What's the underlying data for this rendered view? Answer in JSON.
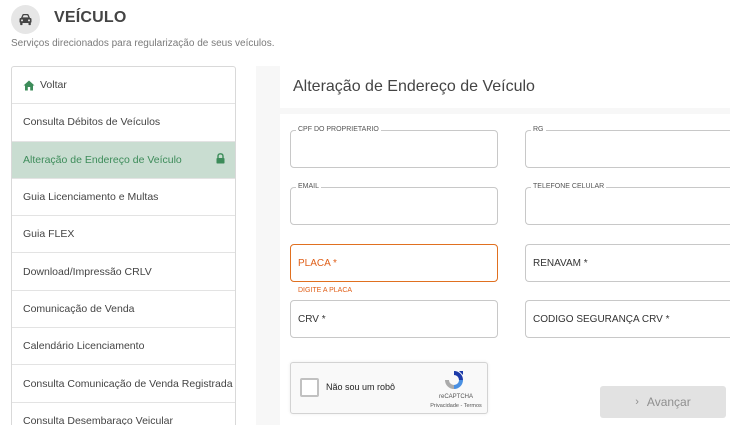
{
  "header": {
    "icon": "car-icon",
    "title": "VEÍCULO",
    "subtitle": "Serviços direcionados para regularização de seus veículos."
  },
  "sidebar": {
    "back_label": "Voltar",
    "items": [
      {
        "label": "Consulta Débitos de Veículos"
      },
      {
        "label": "Alteração de Endereço de Veículo",
        "active": true,
        "icon": "lock-icon"
      },
      {
        "label": "Guia Licenciamento e Multas"
      },
      {
        "label": "Guia FLEX"
      },
      {
        "label": "Download/Impressão CRLV"
      },
      {
        "label": "Comunicação de Venda"
      },
      {
        "label": "Calendário Licenciamento"
      },
      {
        "label": "Consulta Comunicação de Venda Registrada"
      },
      {
        "label": "Consulta Desembaraço Veicular"
      }
    ]
  },
  "form": {
    "title": "Alteração de Endereço de Veículo",
    "cpf_label": "CPF DO PROPRIETARIO",
    "cpf_value": "",
    "rg_label": "RG",
    "rg_value": "",
    "email_label": "EMAIL",
    "email_value": "",
    "phone_label": "TELEFONE CELULAR",
    "phone_value": "",
    "placa_label": "PLACA *",
    "placa_hint": "DIGITE A PLACA",
    "renavam_label": "RENAVAM *",
    "crv_label": "CRV *",
    "crv_code_label": "CODIGO SEGURANÇA CRV *",
    "submit_label": "Avançar"
  },
  "captcha": {
    "label": "Não sou um robô",
    "brand": "reCAPTCHA",
    "links": "Privacidade - Termos"
  },
  "colors": {
    "accent_green": "#3d8c5a",
    "active_bg": "#c9ddd1",
    "error_orange": "#e07020"
  }
}
